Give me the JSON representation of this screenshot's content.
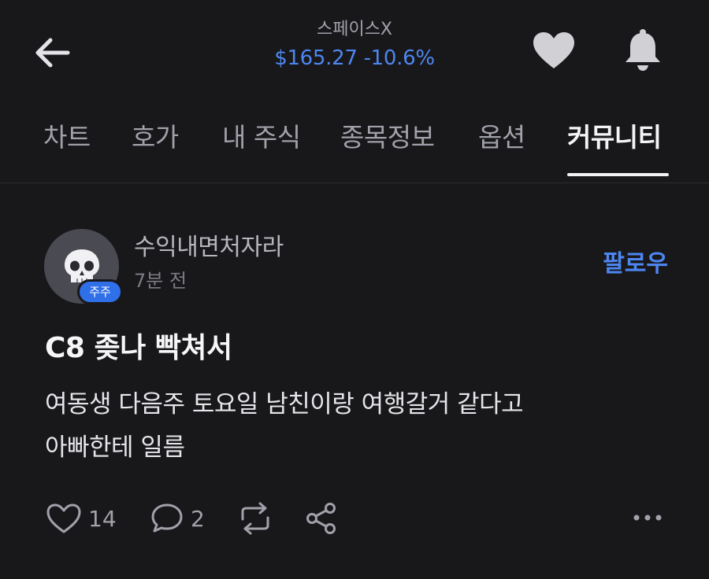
{
  "header": {
    "stock_name": "스페이스X",
    "price": "$165.27",
    "change": "-10.6%",
    "price_color": "#4d86f0",
    "icons": {
      "back": "arrow-left-icon",
      "favorite": "heart-icon",
      "notifications": "bell-icon"
    }
  },
  "tabs": [
    {
      "label": "차트",
      "active": false
    },
    {
      "label": "호가",
      "active": false
    },
    {
      "label": "내 주식",
      "active": false
    },
    {
      "label": "종목정보",
      "active": false
    },
    {
      "label": "옵션",
      "active": false
    },
    {
      "label": "커뮤니티",
      "active": true
    }
  ],
  "post": {
    "author": {
      "name": "수익내면처자라",
      "badge": "주주",
      "avatar_icon": "skull-icon"
    },
    "time": "7분 전",
    "follow_label": "팔로우",
    "title": "C8 좆나 빡쳐서",
    "body_lines": [
      "여동생 다음주 토요일 남친이랑 여행갈거 같다고",
      "아빠한테 일름"
    ],
    "actions": {
      "likes": "14",
      "comments": "2",
      "icons": [
        "heart-outline-icon",
        "comment-icon",
        "repost-icon",
        "share-icon",
        "more-icon"
      ]
    }
  },
  "colors": {
    "background": "#18181b",
    "accent": "#4d86f0",
    "badge": "#2f6fe8"
  }
}
